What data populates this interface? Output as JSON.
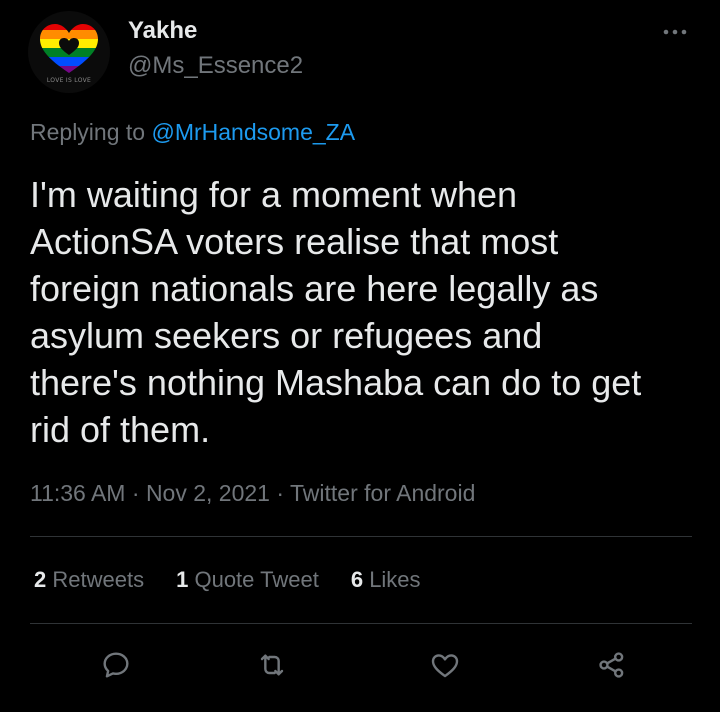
{
  "user": {
    "display_name": "Yakhe",
    "handle": "@Ms_Essence2",
    "avatar_text": "LOVE IS LOVE"
  },
  "reply": {
    "prefix": "Replying to",
    "mention": "@MrHandsome_ZA"
  },
  "tweet": {
    "text": "I'm waiting for a moment when\nActionSA voters realise that most\nforeign nationals are here legally as\nasylum seekers or refugees and\nthere's nothing Mashaba can do to get\nrid of them."
  },
  "meta": {
    "time": "11:36 AM",
    "separator": "·",
    "date": "Nov 2, 2021",
    "source": "Twitter for Android"
  },
  "stats": {
    "retweets": {
      "count": "2",
      "label": "Retweets"
    },
    "quotes": {
      "count": "1",
      "label": "Quote Tweet"
    },
    "likes": {
      "count": "6",
      "label": "Likes"
    }
  },
  "actions": [
    "reply-icon",
    "retweet-icon",
    "like-icon",
    "share-icon"
  ],
  "colors": {
    "background": "#000000",
    "text": "#e7e9ea",
    "secondary": "#71767b",
    "link": "#1d9bf0",
    "divider": "#2f3336"
  }
}
